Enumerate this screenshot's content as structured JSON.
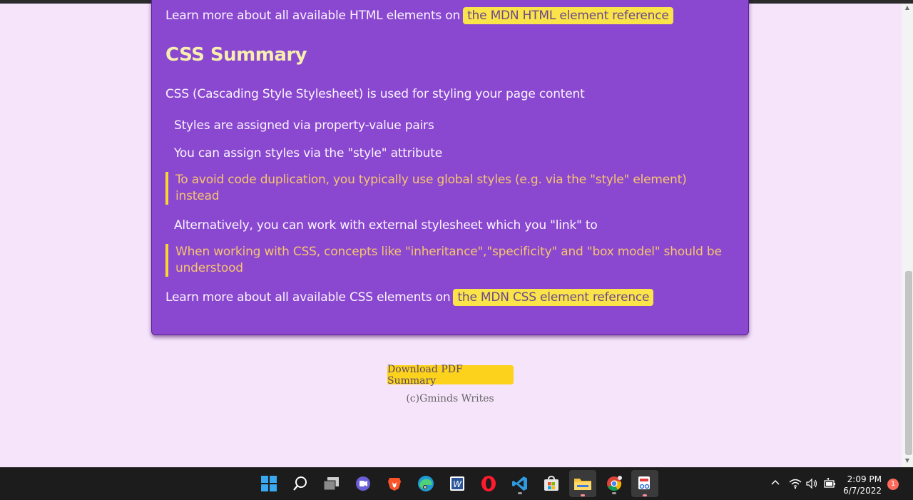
{
  "html_section": {
    "learn_more_text": "Learn more about all available HTML elements on",
    "learn_more_link": "the MDN HTML element reference"
  },
  "css_section": {
    "title": "CSS Summary",
    "intro": "CSS (Cascading Style Stylesheet) is used for styling your page content",
    "items": [
      "Styles are assigned via property-value pairs",
      "You can assign styles via the \"style\" attribute"
    ],
    "callout_1_line1": "To avoid code duplication, you typically use global styles (e.g. via the \"style\" element)",
    "callout_1_line2": "instead",
    "item_3": "Alternatively, you can work with external stylesheet which you \"link\" to",
    "callout_2_line1": "When working with CSS, concepts like \"inheritance\",\"specificity\" and \"box model\" should be",
    "callout_2_line2": "understood",
    "learn_more_text": "Learn more about all available CSS elements on",
    "learn_more_link": "the MDN CSS element reference"
  },
  "footer": {
    "download_label": "Download PDF Summary",
    "credit": "(c)Gminds Writes"
  },
  "taskbar": {
    "time": "2:09 PM",
    "date": "6/7/2022",
    "notification_count": "1",
    "apps": [
      "windows-start-icon",
      "search-icon",
      "task-view-icon",
      "teams-chat-icon",
      "brave-browser-icon",
      "edge-browser-icon",
      "word-icon",
      "opera-browser-icon",
      "vscode-icon",
      "microsoft-store-icon",
      "file-explorer-icon",
      "chrome-icon",
      "snipping-tool-icon"
    ]
  },
  "colors": {
    "page_bg": "#f6e4fb",
    "card_bg": "#8a48d0",
    "title": "#f7efb0",
    "callout_text": "#f7c46e",
    "callout_border": "#fad630",
    "link_chip": "#fbe34a",
    "button_bg": "#fcd21d"
  }
}
